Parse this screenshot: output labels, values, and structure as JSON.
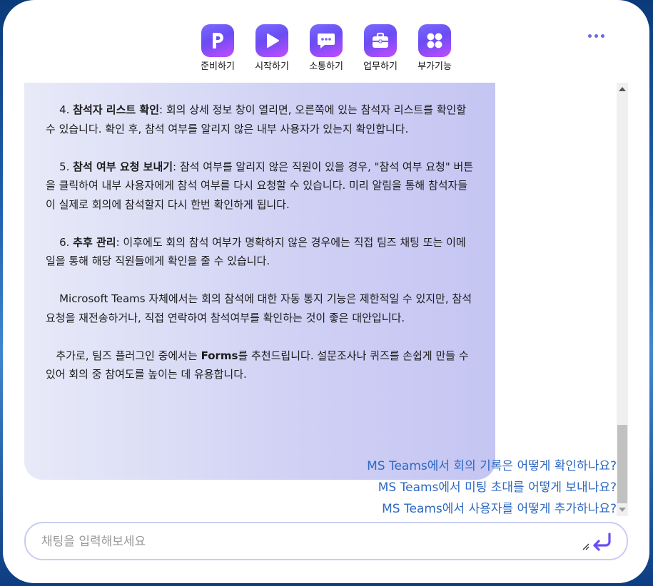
{
  "toolbar": {
    "items": [
      {
        "label": "준비하기",
        "icon": "p-letter-icon"
      },
      {
        "label": "시작하기",
        "icon": "play-icon"
      },
      {
        "label": "소통하기",
        "icon": "chat-bubble-icon"
      },
      {
        "label": "업무하기",
        "icon": "briefcase-icon"
      },
      {
        "label": "부가기능",
        "icon": "grid-icon"
      }
    ]
  },
  "message": {
    "p4": {
      "num": "4.",
      "title": "참석자 리스트 확인",
      "body": ": 회의 상세 정보 창이 열리면, 오른쪽에 있는 참석자 리스트를 확인할 수 있습니다. 확인 후, 참석 여부를 알리지 않은 내부 사용자가 있는지 확인합니다."
    },
    "p5": {
      "num": "5.",
      "title": "참석 여부 요청 보내기",
      "body": ": 참석 여부를 알리지 않은 직원이 있을 경우, \"참석 여부 요청\" 버튼을 클릭하여 내부 사용자에게 참석 여부를 다시 요청할 수 있습니다. 미리 알림을 통해 참석자들이 실제로 회의에 참석할지 다시 한번 확인하게 됩니다."
    },
    "p6": {
      "num": "6.",
      "title": "추후 관리",
      "body": ": 이후에도 회의 참석 여부가 명확하지 않은 경우에는 직접 팀즈 채팅 또는 이메일을 통해 해당 직원들에게 확인을 줄 수 있습니다."
    },
    "p7": "Microsoft Teams 자체에서는 회의 참석에 대한 자동 통지 기능은 제한적일 수 있지만, 참석 요청을 재전송하거나, 직접 연락하여 참석여부를 확인하는 것이 좋은 대안입니다.",
    "p8": {
      "pre": "추가로, 팀즈 플러그인 중에서는 ",
      "bold": "Forms",
      "post": "를 추천드립니다. 설문조사나 퀴즈를 손쉽게 만들 수 있어 회의 중 참여도를 높이는 데 유용합니다."
    }
  },
  "suggestions": [
    "MS Teams에서 회의 기록은 어떻게 확인하나요?",
    "MS Teams에서 미팅 초대를 어떻게 보내나요?",
    "MS Teams에서 사용자를 어떻게 추가하나요?"
  ],
  "input": {
    "placeholder": "채팅을 입력해보세요",
    "value": ""
  },
  "colors": {
    "accent": "#6a4cf3",
    "suggestion": "#2e68c2",
    "bubble": "#cfd0f4"
  }
}
